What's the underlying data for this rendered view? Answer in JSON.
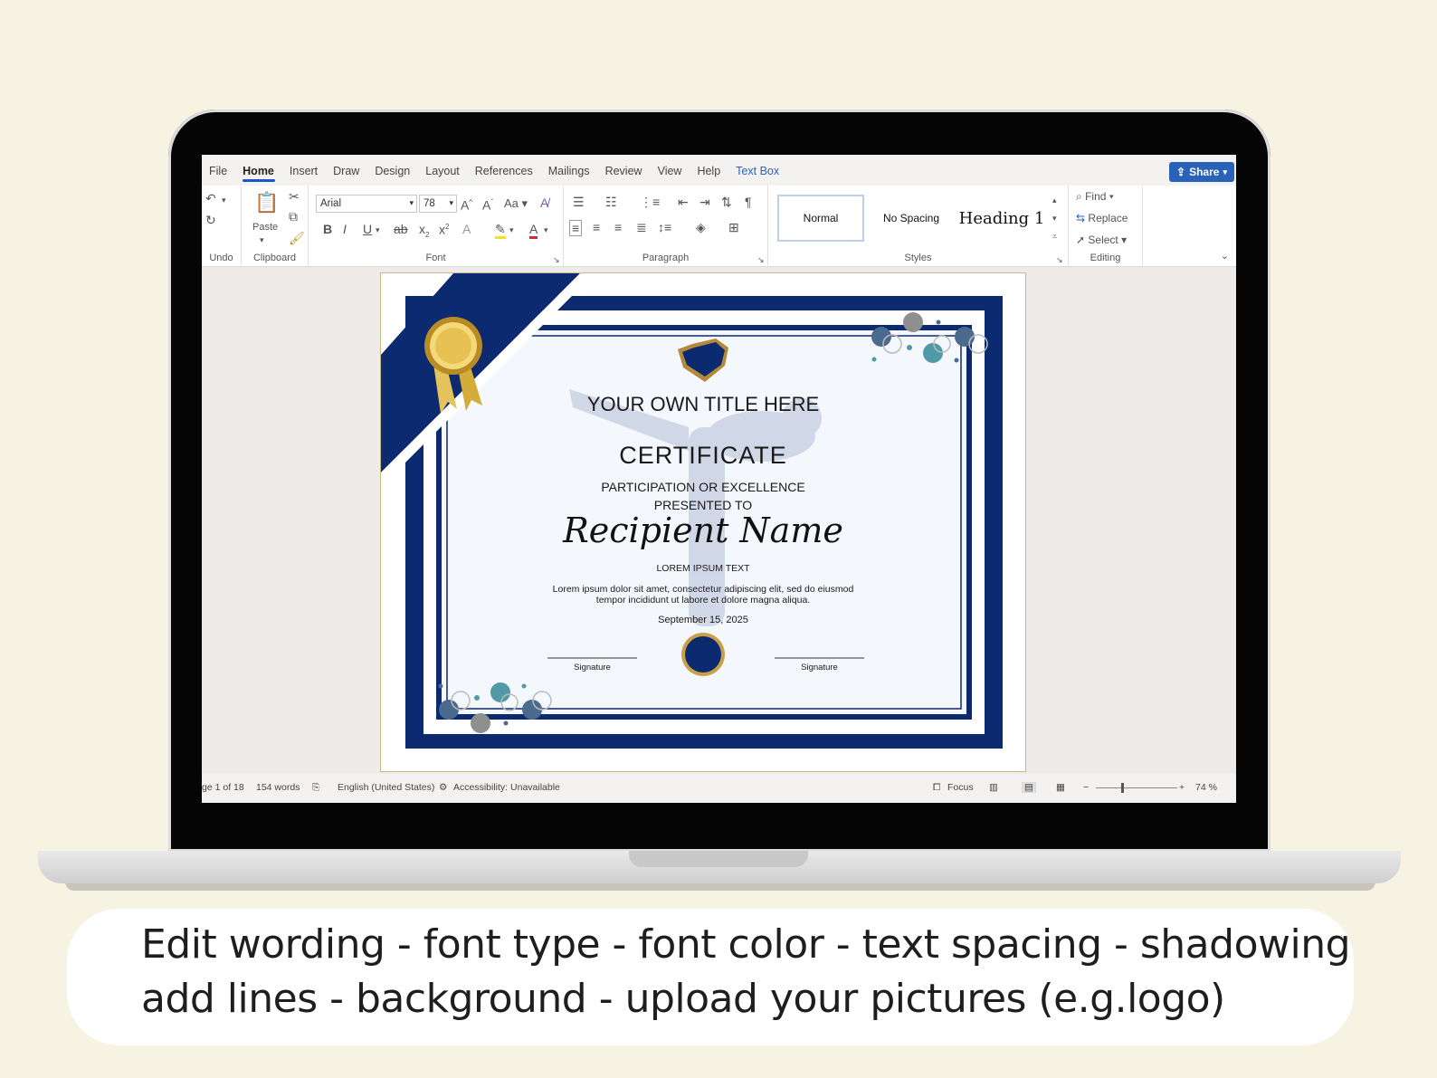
{
  "tabs": [
    "File",
    "Home",
    "Insert",
    "Draw",
    "Design",
    "Layout",
    "References",
    "Mailings",
    "Review",
    "View",
    "Help",
    "Text Box"
  ],
  "share_label": "Share",
  "ribbon": {
    "undo_label": "Undo",
    "clipboard": {
      "paste_label": "Paste",
      "group_label": "Clipboard"
    },
    "font": {
      "name": "Arial",
      "size": "78",
      "case_label": "Aa",
      "group_label": "Font"
    },
    "paragraph": {
      "group_label": "Paragraph"
    },
    "styles": {
      "items": [
        "Normal",
        "No Spacing",
        "Heading 1"
      ],
      "group_label": "Styles"
    },
    "editing": {
      "find": "Find",
      "replace": "Replace",
      "select": "Select",
      "group_label": "Editing"
    }
  },
  "certificate": {
    "own_title": "YOUR OWN TITLE HERE",
    "title": "CERTIFICATE",
    "subtitle1": "PARTICIPATION OR EXCELLENCE",
    "subtitle2": "PRESENTED TO",
    "recipient": "Recipient Name",
    "lorem_heading": "LOREM IPSUM TEXT",
    "body_line1": "Lorem ipsum dolor sit amet, consectetur adipiscing elit, sed do eiusmod",
    "body_line2": "tempor incididunt ut labore et dolore magna aliqua.",
    "date": "September 15, 2025",
    "signature_left": "Signature",
    "signature_right": "Signature"
  },
  "status": {
    "page": "ge 1 of 18",
    "words": "154 words",
    "language": "English (United States)",
    "accessibility": "Accessibility: Unavailable",
    "focus": "Focus",
    "zoom": "74 %"
  },
  "caption": {
    "line1": "Edit wording - font type - font color - text spacing - shadowing",
    "line2": "add lines - background -  upload your pictures (e.g.logo)"
  },
  "colors": {
    "navy": "#0b2a6f",
    "accent_blue": "#185abd",
    "teal": "#4f9aa6",
    "gold": "#d7b24a"
  }
}
